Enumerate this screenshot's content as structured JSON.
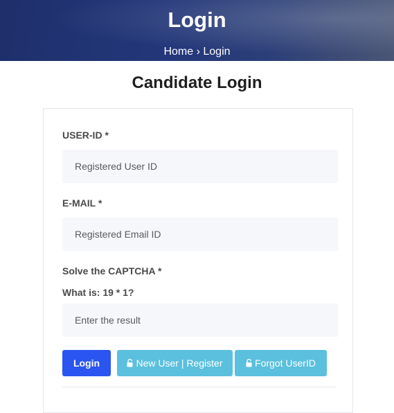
{
  "banner": {
    "title": "Login",
    "breadcrumb": {
      "home": "Home",
      "separator": "›",
      "current": "Login"
    }
  },
  "page": {
    "title": "Candidate Login"
  },
  "form": {
    "user_id_label": "USER-ID *",
    "user_id_placeholder": "Registered User ID",
    "email_label": "E-MAIL *",
    "email_placeholder": "Registered Email ID",
    "captcha_label": "Solve the CAPTCHA *",
    "captcha_question": "What is: 19 * 1?",
    "captcha_placeholder": "Enter the result"
  },
  "buttons": {
    "login": "Login",
    "register": "New User | Register",
    "forgot": "Forgot UserID",
    "register_icon": "unlock-icon",
    "forgot_icon": "unlock-icon"
  },
  "colors": {
    "banner": "#23377a",
    "login_button": "#2b55f0",
    "info_button": "#5bc0de",
    "field_background": "#f6f7fb"
  }
}
